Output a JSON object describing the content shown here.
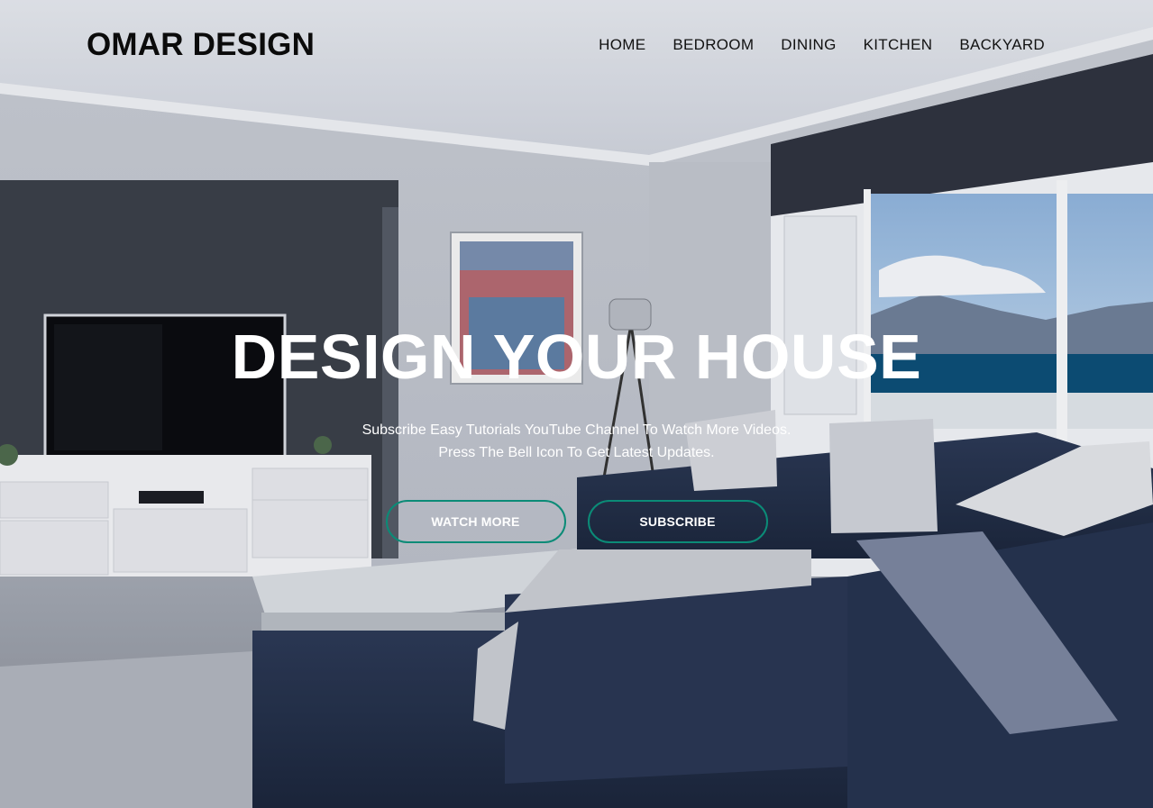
{
  "header": {
    "logo": "OMAR DESIGN",
    "nav": [
      {
        "label": "HOME"
      },
      {
        "label": "BEDROOM"
      },
      {
        "label": "DINING"
      },
      {
        "label": "KITCHEN"
      },
      {
        "label": "BACKYARD"
      }
    ]
  },
  "hero": {
    "title": "DESIGN YOUR HOUSE",
    "subtitle_line1": "Subscribe Easy Tutorials YouTube Channel To Watch More Videos.",
    "subtitle_line2": "Press The Bell Icon To Get Latest Updates.",
    "buttons": {
      "watch_more": "WATCH MORE",
      "subscribe": "SUBSCRIBE"
    }
  },
  "colors": {
    "accent": "#0b8b77",
    "text_dark": "#111111",
    "text_light": "#ffffff"
  }
}
